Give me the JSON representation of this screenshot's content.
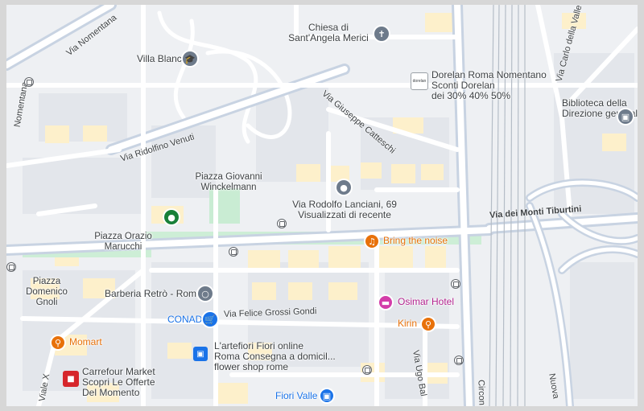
{
  "map": {
    "streets": {
      "via_nomentana": "Via Nomentana",
      "via_nomentana_short": "Nomentana",
      "via_rodolfino_venuti": "Via Ridolfino Venuti",
      "via_giuseppe_catteschi": "Via Giuseppe Catteschi",
      "via_dei_monti_tiburtini": "Via dei Monti Tiburtini",
      "via_felice_grossi_gondi": "Via Felice Grossi Gondi",
      "via_carlo_della_valle": "Via Carlo della Valle",
      "viale_x": "Viale X",
      "via_ugo_bal": "Via Ugo Bal",
      "circon": "Circon",
      "nuova": "Nuova"
    },
    "squares": {
      "piazza_giovanni_winckelmann_line1": "Piazza Giovanni",
      "piazza_giovanni_winckelmann_line2": "Winckelmann",
      "piazza_orazio_marucchi_line1": "Piazza Orazio",
      "piazza_orazio_marucchi_line2": "Marucchi",
      "piazza_domenico_gnoli_line1": "Piazza",
      "piazza_domenico_gnoli_line2": "Domenico",
      "piazza_domenico_gnoli_line3": "Gnoli"
    },
    "places": {
      "villa_blanc": "Villa Blanc",
      "chiesa_line1": "Chiesa di",
      "chiesa_line2": "Sant'Angela Merici",
      "dorelan_name": "Dorelan Roma Nomentano",
      "dorelan_sub1": "Sconti Dorelan",
      "dorelan_sub2": "dei 30% 40% 50%",
      "dorelan_logo": "dorelan",
      "biblioteca_line1": "Biblioteca della",
      "biblioteca_line2": "Direzione generale...",
      "lanciani_name": "Via Rodolfo Lanciani, 69",
      "lanciani_sub": "Visualizzati di recente",
      "bring_the_noise": "Bring the noise",
      "barberia": "Barberia Retrò - Roma",
      "conad": "CONAD",
      "osimar_hotel": "Osimar Hotel",
      "kirin": "Kirin",
      "momart": "Momart",
      "artefiori_line1": "L'artefiori Fiori online",
      "artefiori_line2": "Roma Consegna a domicil...",
      "artefiori_sub": "flower shop rome",
      "carrefour_name": "Carrefour Market",
      "carrefour_sub1": "Scopri Le Offerte",
      "carrefour_sub2": "Del Momento",
      "fiori_valle": "Fiori Valle"
    },
    "icons": {
      "church": "church-icon",
      "school": "school-icon",
      "book": "book-icon",
      "pin": "location-pin-icon",
      "park": "park-icon",
      "music": "music-venue-icon",
      "barber": "barber-icon",
      "shopping": "shopping-cart-icon",
      "hotel": "hotel-icon",
      "restaurant": "restaurant-icon",
      "shop_bag": "shopping-bag-icon",
      "bus": "bus-stop-icon"
    },
    "colors": {
      "land": "#eef0f3",
      "block": "#e2e5ea",
      "road": "#ffffff",
      "road_major": "#c7d3e3",
      "park": "#c6ead1",
      "building_yellow": "#fdf1cf",
      "orange": "#e8710a",
      "blue": "#1a73e8",
      "pink": "#d33da9",
      "teal": "#188038",
      "grey_pin": "#6e7b8b",
      "rail": "#a9b2bd"
    }
  }
}
